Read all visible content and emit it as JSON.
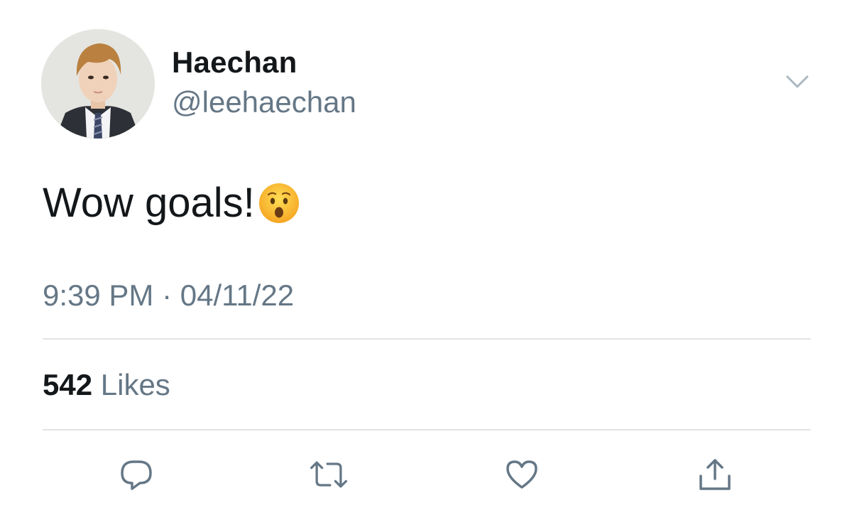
{
  "tweet": {
    "author": {
      "display_name": "Haechan",
      "handle": "@leehaechan"
    },
    "text": "Wow goals!",
    "emoji": "hushed-face-emoji",
    "timestamp": "9:39 PM · 04/11/22",
    "likes": {
      "count": "542",
      "label": "Likes"
    }
  },
  "actions": [
    {
      "name": "reply",
      "icon": "comment-bubble-icon"
    },
    {
      "name": "retweet",
      "icon": "retweet-icon"
    },
    {
      "name": "like",
      "icon": "heart-icon"
    },
    {
      "name": "share",
      "icon": "share-icon"
    }
  ],
  "colors": {
    "text": "#14171a",
    "secondary": "#657786",
    "divider": "#e1e4e6",
    "background": "#ffffff"
  }
}
